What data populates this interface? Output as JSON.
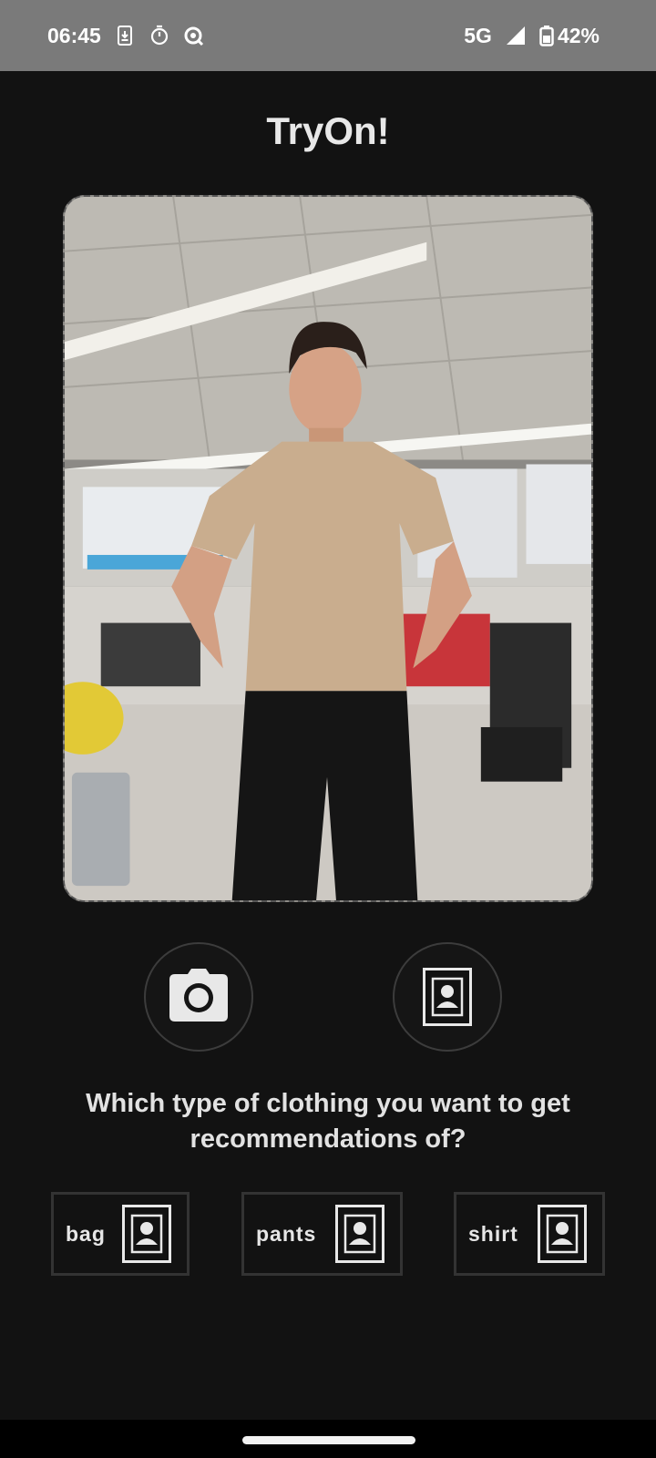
{
  "status_bar": {
    "time": "06:45",
    "network": "5G",
    "battery": "42%",
    "icons": [
      "download-icon",
      "timer-icon",
      "data-saver-icon",
      "signal-icon",
      "battery-icon"
    ]
  },
  "app": {
    "title": "TryOn!"
  },
  "photo": {
    "description_icon": "user-photo-icon"
  },
  "actions": {
    "camera_icon": "camera-icon",
    "gallery_icon": "portrait-icon"
  },
  "question": "Which type of clothing you want to get recommendations of?",
  "categories": [
    {
      "label": "bag",
      "icon": "portrait-icon"
    },
    {
      "label": "pants",
      "icon": "portrait-icon"
    },
    {
      "label": "shirt",
      "icon": "portrait-icon"
    }
  ],
  "colors": {
    "background": "#121212",
    "status_bar": "#7a7a7a",
    "text": "#e6e6e6"
  }
}
